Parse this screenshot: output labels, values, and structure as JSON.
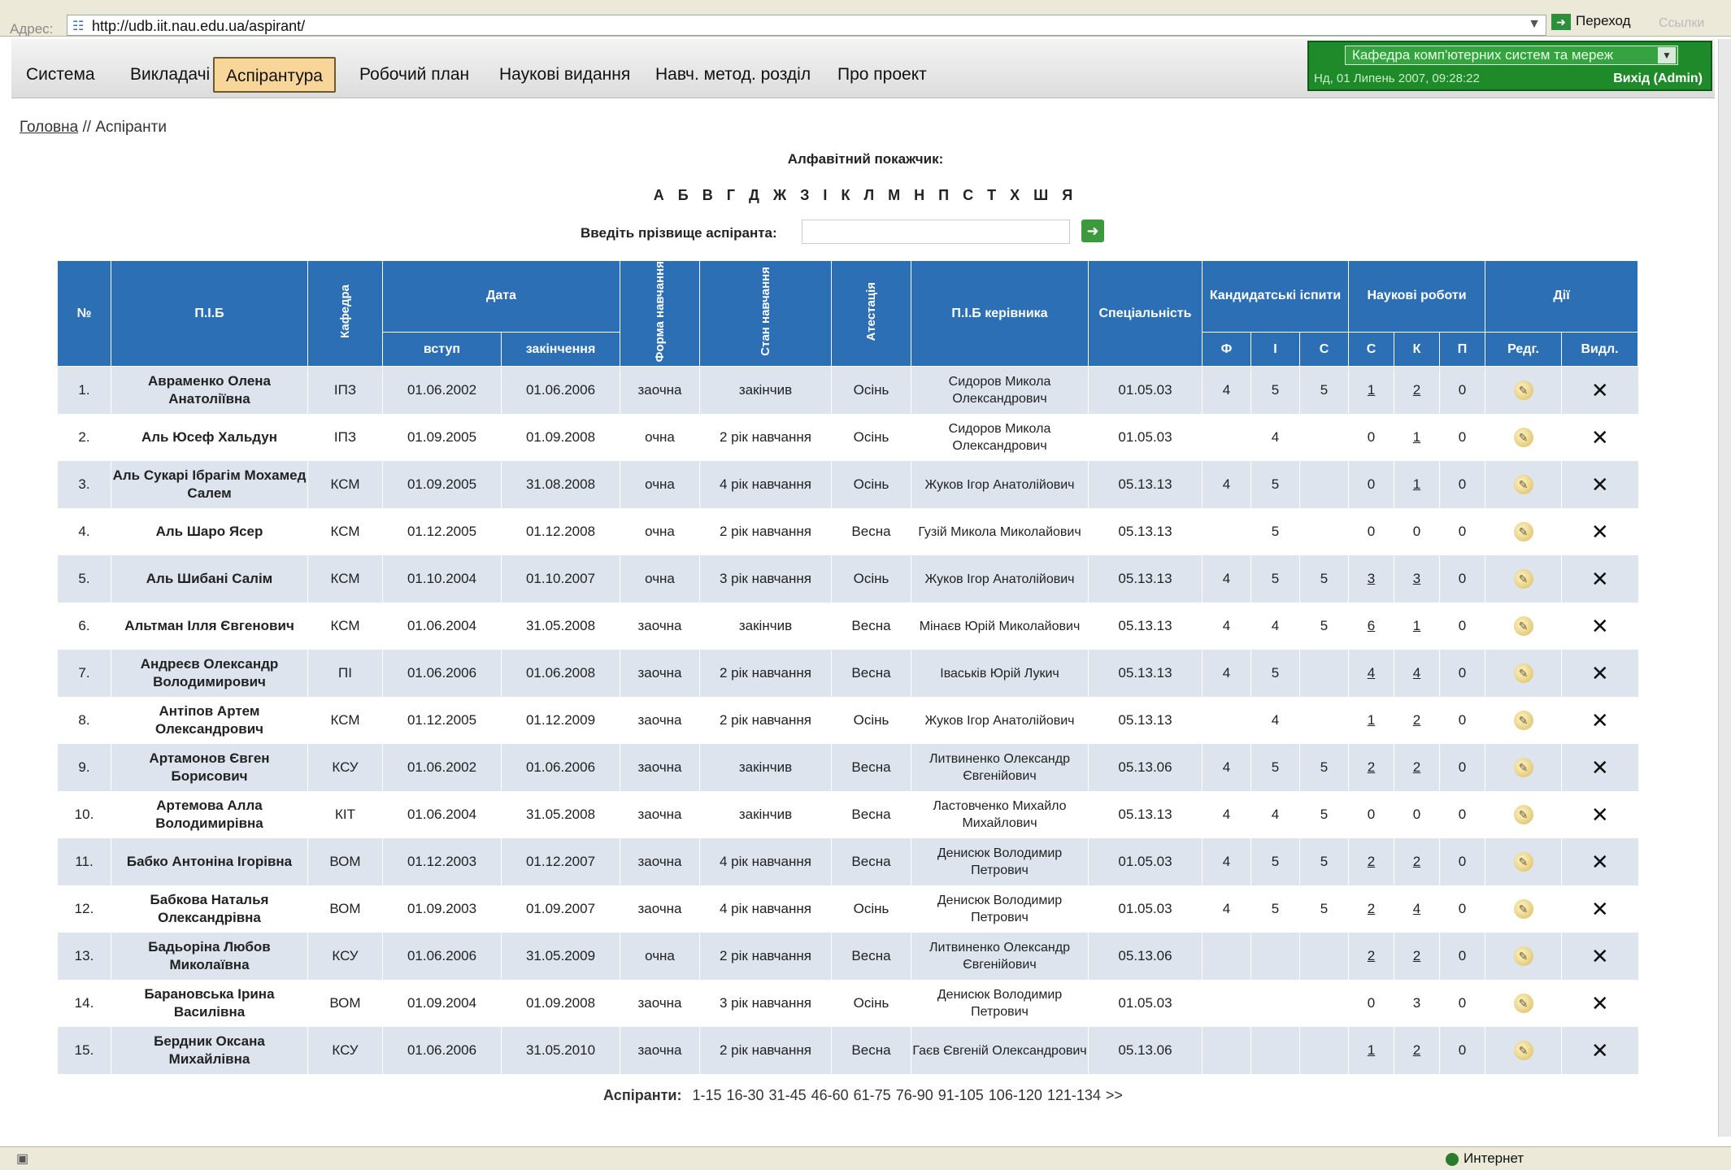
{
  "browser": {
    "address_label": "Адрес:",
    "url": "http://udb.iit.nau.edu.ua/aspirant/",
    "go_label": "Переход",
    "links_label": "Ссылки",
    "status_zone": "Интернет"
  },
  "nav": {
    "items": [
      {
        "label": "Система"
      },
      {
        "label": "Викладачі"
      },
      {
        "label": "Аспірантура",
        "active": true
      },
      {
        "label": "Робочий план"
      },
      {
        "label": "Наукові видання"
      },
      {
        "label": "Навч. метод. розділ"
      },
      {
        "label": "Про проект"
      }
    ]
  },
  "user_panel": {
    "department": "Кафедра комп'ютерних систем та мереж",
    "datetime": "Нд, 01 Липень 2007, 09:28:22",
    "user": "Вихід (Admin)"
  },
  "breadcrumb": {
    "home": "Головна",
    "separator": "//",
    "current": "Аспіранти"
  },
  "alphabet": {
    "title": "Алфавітний покажчик:",
    "letters": [
      "А",
      "Б",
      "В",
      "Г",
      "Д",
      "Ж",
      "З",
      "І",
      "К",
      "Л",
      "М",
      "Н",
      "П",
      "С",
      "Т",
      "Х",
      "Ш",
      "Я"
    ]
  },
  "search": {
    "label": "Введіть прізвище аспіранта:",
    "value": ""
  },
  "table": {
    "headers": {
      "num": "№",
      "name": "П.І.Б",
      "dept": "Кафедра",
      "date": "Дата",
      "date_start": "вступ",
      "date_end": "закінчення",
      "form": "Форма навчання",
      "status": "Стан навчання",
      "attest": "Атестація",
      "supervisor": "П.І.Б керівника",
      "specialty": "Спеціальність",
      "exams": "Кандидатські іспити",
      "exam_f": "Ф",
      "exam_i": "І",
      "exam_s": "С",
      "works": "Наукові роботи",
      "work_s": "С",
      "work_k": "К",
      "work_p": "П",
      "actions": "Дії",
      "edit": "Редг.",
      "del": "Видл."
    },
    "rows": [
      {
        "num": "1.",
        "name": "Авраменко Олена Анатоліївна",
        "dept": "ІПЗ",
        "start": "01.06.2002",
        "end": "01.06.2006",
        "form": "заочна",
        "status": "закінчив",
        "attest": "Осінь",
        "sup": "Сидоров Микола Олександрович",
        "spec": "01.05.03",
        "f": "4",
        "i": "5",
        "s": "5",
        "ws": "1",
        "wk": "2",
        "wp": "0",
        "ws_link": true,
        "wk_link": true
      },
      {
        "num": "2.",
        "name": "Аль Юсеф Хальдун",
        "dept": "ІПЗ",
        "start": "01.09.2005",
        "end": "01.09.2008",
        "form": "очна",
        "status": "2 рік навчання",
        "attest": "Осінь",
        "sup": "Сидоров Микола Олександрович",
        "spec": "01.05.03",
        "f": "",
        "i": "4",
        "s": "",
        "ws": "0",
        "wk": "1",
        "wp": "0",
        "ws_link": false,
        "wk_link": true
      },
      {
        "num": "3.",
        "name": "Аль Сукарі Ібрагім Мохамед Салем",
        "dept": "КСМ",
        "start": "01.09.2005",
        "end": "31.08.2008",
        "form": "очна",
        "status": "4 рік навчання",
        "attest": "Осінь",
        "sup": "Жуков Ігор Анатолійович",
        "spec": "05.13.13",
        "f": "4",
        "i": "5",
        "s": "",
        "ws": "0",
        "wk": "1",
        "wp": "0",
        "ws_link": false,
        "wk_link": true
      },
      {
        "num": "4.",
        "name": "Аль Шаро Ясер",
        "dept": "КСМ",
        "start": "01.12.2005",
        "end": "01.12.2008",
        "form": "очна",
        "status": "2 рік навчання",
        "attest": "Весна",
        "sup": "Гузій Микола Миколайович",
        "spec": "05.13.13",
        "f": "",
        "i": "5",
        "s": "",
        "ws": "0",
        "wk": "0",
        "wp": "0",
        "ws_link": false,
        "wk_link": false
      },
      {
        "num": "5.",
        "name": "Аль Шибані Салім",
        "dept": "КСМ",
        "start": "01.10.2004",
        "end": "01.10.2007",
        "form": "очна",
        "status": "3 рік навчання",
        "attest": "Осінь",
        "sup": "Жуков Ігор Анатолійович",
        "spec": "05.13.13",
        "f": "4",
        "i": "5",
        "s": "5",
        "ws": "3",
        "wk": "3",
        "wp": "0",
        "ws_link": true,
        "wk_link": true
      },
      {
        "num": "6.",
        "name": "Альтман Ілля Євгенович",
        "dept": "КСМ",
        "start": "01.06.2004",
        "end": "31.05.2008",
        "form": "заочна",
        "status": "закінчив",
        "attest": "Весна",
        "sup": "Мінаєв Юрій Миколайович",
        "spec": "05.13.13",
        "f": "4",
        "i": "4",
        "s": "5",
        "ws": "6",
        "wk": "1",
        "wp": "0",
        "ws_link": true,
        "wk_link": true
      },
      {
        "num": "7.",
        "name": "Андреєв Олександр Володимирович",
        "dept": "ПІ",
        "start": "01.06.2006",
        "end": "01.06.2008",
        "form": "заочна",
        "status": "2 рік навчання",
        "attest": "Весна",
        "sup": "Іваськів Юрій Лукич",
        "spec": "05.13.13",
        "f": "4",
        "i": "5",
        "s": "",
        "ws": "4",
        "wk": "4",
        "wp": "0",
        "ws_link": true,
        "wk_link": true
      },
      {
        "num": "8.",
        "name": "Антіпов Артем Олександрович",
        "dept": "КСМ",
        "start": "01.12.2005",
        "end": "01.12.2009",
        "form": "заочна",
        "status": "2 рік навчання",
        "attest": "Осінь",
        "sup": "Жуков Ігор Анатолійович",
        "spec": "05.13.13",
        "f": "",
        "i": "4",
        "s": "",
        "ws": "1",
        "wk": "2",
        "wp": "0",
        "ws_link": true,
        "wk_link": true
      },
      {
        "num": "9.",
        "name": "Артамонов Євген Борисович",
        "dept": "КСУ",
        "start": "01.06.2002",
        "end": "01.06.2006",
        "form": "заочна",
        "status": "закінчив",
        "attest": "Весна",
        "sup": "Литвиненко Олександр Євгенійович",
        "spec": "05.13.06",
        "f": "4",
        "i": "5",
        "s": "5",
        "ws": "2",
        "wk": "2",
        "wp": "0",
        "ws_link": true,
        "wk_link": true
      },
      {
        "num": "10.",
        "name": "Артемова Алла Володимирівна",
        "dept": "КІТ",
        "start": "01.06.2004",
        "end": "31.05.2008",
        "form": "заочна",
        "status": "закінчив",
        "attest": "Весна",
        "sup": "Ластовченко Михайло Михайлович",
        "spec": "05.13.13",
        "f": "4",
        "i": "4",
        "s": "5",
        "ws": "0",
        "wk": "0",
        "wp": "0",
        "ws_link": false,
        "wk_link": false
      },
      {
        "num": "11.",
        "name": "Бабко Антоніна Ігорівна",
        "dept": "ВОМ",
        "start": "01.12.2003",
        "end": "01.12.2007",
        "form": "заочна",
        "status": "4 рік навчання",
        "attest": "Весна",
        "sup": "Денисюк Володимир Петрович",
        "spec": "01.05.03",
        "f": "4",
        "i": "5",
        "s": "5",
        "ws": "2",
        "wk": "2",
        "wp": "0",
        "ws_link": true,
        "wk_link": true
      },
      {
        "num": "12.",
        "name": "Бабкова Наталья Олександрівна",
        "dept": "ВОМ",
        "start": "01.09.2003",
        "end": "01.09.2007",
        "form": "заочна",
        "status": "4 рік навчання",
        "attest": "Осінь",
        "sup": "Денисюк Володимир Петрович",
        "spec": "01.05.03",
        "f": "4",
        "i": "5",
        "s": "5",
        "ws": "2",
        "wk": "4",
        "wp": "0",
        "ws_link": true,
        "wk_link": true
      },
      {
        "num": "13.",
        "name": "Бадьоріна Любов Миколаївна",
        "dept": "КСУ",
        "start": "01.06.2006",
        "end": "31.05.2009",
        "form": "очна",
        "status": "2 рік навчання",
        "attest": "Весна",
        "sup": "Литвиненко Олександр Євгенійович",
        "spec": "05.13.06",
        "f": "",
        "i": "",
        "s": "",
        "ws": "2",
        "wk": "2",
        "wp": "0",
        "ws_link": true,
        "wk_link": true
      },
      {
        "num": "14.",
        "name": "Барановська Ірина Василівна",
        "dept": "ВОМ",
        "start": "01.09.2004",
        "end": "01.09.2008",
        "form": "заочна",
        "status": "3 рік навчання",
        "attest": "Осінь",
        "sup": "Денисюк Володимир Петрович",
        "spec": "01.05.03",
        "f": "",
        "i": "",
        "s": "",
        "ws": "0",
        "wk": "3",
        "wp": "0",
        "ws_link": false,
        "wk_link": false
      },
      {
        "num": "15.",
        "name": "Бердник Оксана Михайлівна",
        "dept": "КСУ",
        "start": "01.06.2006",
        "end": "31.05.2010",
        "form": "заочна",
        "status": "2 рік навчання",
        "attest": "Весна",
        "sup": "Гаєв Євгеній Олександрович",
        "spec": "05.13.06",
        "f": "",
        "i": "",
        "s": "",
        "ws": "1",
        "wk": "2",
        "wp": "0",
        "ws_link": true,
        "wk_link": true
      }
    ]
  },
  "pager": {
    "label": "Аспіранти:",
    "pages": [
      "1-15",
      "16-30",
      "31-45",
      "46-60",
      "61-75",
      "76-90",
      "91-105",
      "106-120",
      "121-134",
      ">>"
    ]
  }
}
